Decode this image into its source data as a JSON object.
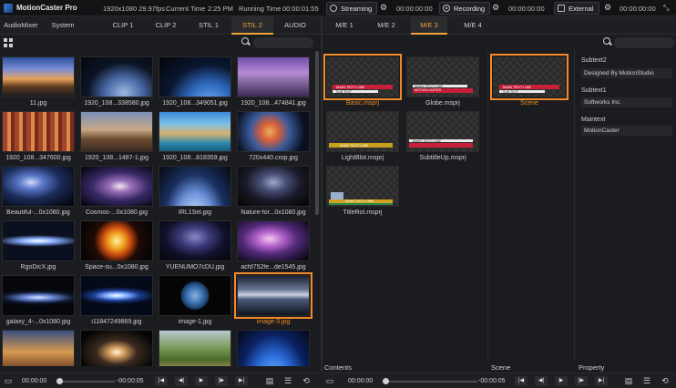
{
  "app": {
    "title": "MotionCaster Pro",
    "resolution": "1920x1080 29.97fps",
    "current_time_label": "Current Time",
    "current_time": "2:25 PM",
    "running_time_label": "Running Time",
    "running_time": "00:00:01:55"
  },
  "top_controls": {
    "streaming_label": "Streaming",
    "streaming_time": "00:00:00:00",
    "recording_label": "Recording",
    "recording_time": "00:00:00:00",
    "external_label": "External",
    "external_time": "00:00:00:00"
  },
  "left_tabs": [
    {
      "label": "AudioMixer"
    },
    {
      "label": "System"
    },
    {
      "label": "CLIP 1"
    },
    {
      "label": "CLIP 2"
    },
    {
      "label": "STIL 1"
    },
    {
      "label": "STIL 2",
      "active": true
    },
    {
      "label": "AUDIO"
    }
  ],
  "right_tabs": [
    {
      "label": "M/E 1"
    },
    {
      "label": "M/E 2"
    },
    {
      "label": "M/E 3",
      "active": true
    },
    {
      "label": "M/E 4"
    }
  ],
  "stills": [
    {
      "caption": "11.jpg"
    },
    {
      "caption": "1920_108...338580.jpg"
    },
    {
      "caption": "1920_108...349051.jpg"
    },
    {
      "caption": "1920_108...474841.jpg"
    },
    {
      "caption": "1920_108...347600.jpg"
    },
    {
      "caption": "1920_108...1487-1.jpg"
    },
    {
      "caption": "1920_108...818359.jpg"
    },
    {
      "caption": "720x440.crop.jpg"
    },
    {
      "caption": "Beautiful-...0x1080.jpg"
    },
    {
      "caption": "Cosmos-...0x1080.jpg"
    },
    {
      "caption": "IRL1Sel.jpg"
    },
    {
      "caption": "Nature-for...0x1080.jpg"
    },
    {
      "caption": "RgoDicX.jpg"
    },
    {
      "caption": "Space-su...0x1080.jpg"
    },
    {
      "caption": "YUENUMO7cDU.jpg"
    },
    {
      "caption": "acfd752fe...de1545.jpg"
    },
    {
      "caption": "galaxy_4-...0x1080.jpg"
    },
    {
      "caption": "i11847249869.jpg"
    },
    {
      "caption": "image-1.jpg"
    },
    {
      "caption": "image-3.jpg",
      "selected": true
    },
    {
      "caption": ""
    },
    {
      "caption": ""
    },
    {
      "caption": ""
    },
    {
      "caption": ""
    }
  ],
  "contents": [
    {
      "caption": "Basic.msprj",
      "selected": true,
      "t1": "MAIN TEXT LINE",
      "t2": "SUB TEXT"
    },
    {
      "caption": "Globe.msprj",
      "t1": "MAIN TEXT LINE",
      "t2": "MOTION CASTER"
    },
    {
      "caption": "LightBlot.msprj",
      "t1": "MAIN TEXT LINE"
    },
    {
      "caption": "SubtitleUp.msprj",
      "t1": "MAIN TEXT LINE"
    },
    {
      "caption": "TitleRot.msprj",
      "t1": "MAIN TEXT LINE"
    }
  ],
  "scene": {
    "caption": "Scene",
    "t1": "MAIN TEXT LINE",
    "t2": "SUB TEXT"
  },
  "properties": [
    {
      "label": "Subtext2",
      "value": "Designed By MotionStudio"
    },
    {
      "label": "Subtext1",
      "value": "Softworks Inc."
    },
    {
      "label": "Maintext",
      "value": "MotionCaster"
    }
  ],
  "sections": {
    "contents": "Contents",
    "scene": "Scene",
    "property": "Property"
  },
  "transport_left": {
    "start": "00:00:00",
    "end": "-00:00:05"
  },
  "transport_right": {
    "start": "00:00:00",
    "end": "-00:00:05"
  },
  "transport_buttons": [
    "|◀",
    "◀|",
    "▶",
    "|▶",
    "▶|"
  ],
  "colors": {
    "accent": "#f0a23a",
    "selection": "#f08a2a"
  }
}
